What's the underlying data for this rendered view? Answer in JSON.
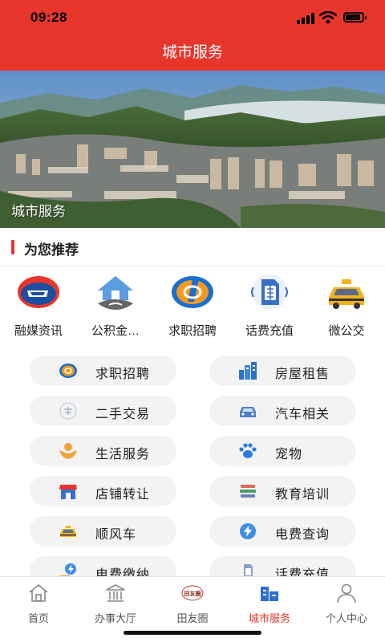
{
  "status": {
    "time": "09:28"
  },
  "header": {
    "title": "城市服务"
  },
  "banner": {
    "caption": "城市服务"
  },
  "recommend": {
    "title": "为您推荐",
    "items": [
      {
        "label": "融媒资讯",
        "icon": "media-news-icon"
      },
      {
        "label": "公积金…",
        "icon": "housing-fund-icon"
      },
      {
        "label": "求职招聘",
        "icon": "job-icon"
      },
      {
        "label": "话费充值",
        "icon": "sim-card-icon"
      },
      {
        "label": "微公交",
        "icon": "taxi-icon"
      }
    ]
  },
  "services": [
    {
      "label": "求职招聘",
      "icon": "job-icon"
    },
    {
      "label": "房屋租售",
      "icon": "buildings-icon"
    },
    {
      "label": "二手交易",
      "icon": "second-hand-icon"
    },
    {
      "label": "汽车相关",
      "icon": "car-icon"
    },
    {
      "label": "生活服务",
      "icon": "life-service-icon"
    },
    {
      "label": "宠物",
      "icon": "paw-icon"
    },
    {
      "label": "店铺转让",
      "icon": "shop-icon"
    },
    {
      "label": "教育培训",
      "icon": "books-icon"
    },
    {
      "label": "顺风车",
      "icon": "taxi-icon"
    },
    {
      "label": "电费查询",
      "icon": "electricity-query-icon"
    },
    {
      "label": "电费缴纳",
      "icon": "electricity-pay-icon"
    },
    {
      "label": "话费充值",
      "icon": "sim-card-icon"
    }
  ],
  "tabs": [
    {
      "label": "首页",
      "icon": "home-icon"
    },
    {
      "label": "办事大厅",
      "icon": "hall-icon"
    },
    {
      "label": "田友圈",
      "icon": "circle-logo-icon",
      "logo_text": "田友圈"
    },
    {
      "label": "城市服务",
      "icon": "city-service-icon",
      "active": true
    },
    {
      "label": "个人中心",
      "icon": "user-icon"
    }
  ],
  "colors": {
    "accent": "#e8352b",
    "pill_bg": "#f3f3f3"
  }
}
